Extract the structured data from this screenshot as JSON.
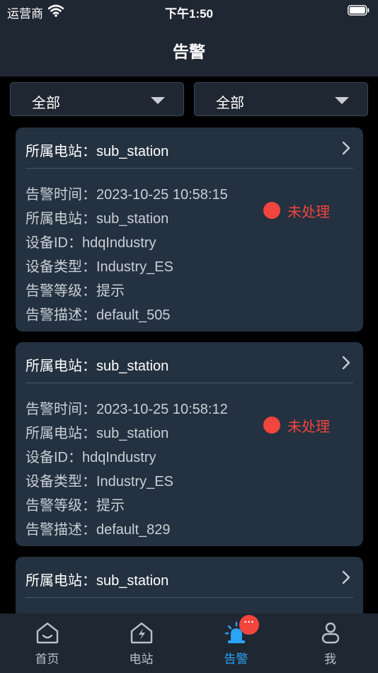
{
  "status_bar": {
    "carrier": "运营商",
    "time": "下午1:50"
  },
  "nav": {
    "title": "告警"
  },
  "filters": [
    {
      "label": "全部"
    },
    {
      "label": "全部"
    }
  ],
  "alarms": [
    {
      "title": "所属电站：sub_station",
      "fields": [
        "告警时间：2023-10-25 10:58:15",
        "所属电站：sub_station",
        "设备ID：hdqIndustry",
        "设备类型：Industry_ES",
        "告警等级：提示",
        "告警描述：default_505"
      ],
      "status": "未处理"
    },
    {
      "title": "所属电站：sub_station",
      "fields": [
        "告警时间：2023-10-25 10:58:12",
        "所属电站：sub_station",
        "设备ID：hdqIndustry",
        "设备类型：Industry_ES",
        "告警等级：提示",
        "告警描述：default_829"
      ],
      "status": "未处理"
    },
    {
      "title": "所属电站：sub_station"
    }
  ],
  "tabs": [
    {
      "label": "首页",
      "icon": "home-icon"
    },
    {
      "label": "电站",
      "icon": "station-icon"
    },
    {
      "label": "告警",
      "icon": "alarm-siren-icon",
      "active": true
    },
    {
      "label": "我",
      "icon": "user-icon"
    }
  ],
  "badge": {
    "text": "···"
  },
  "colors": {
    "accent": "#2aa4f4",
    "status_red": "#f1453e",
    "card_bg": "#243140",
    "bar_bg": "#1f2733"
  }
}
